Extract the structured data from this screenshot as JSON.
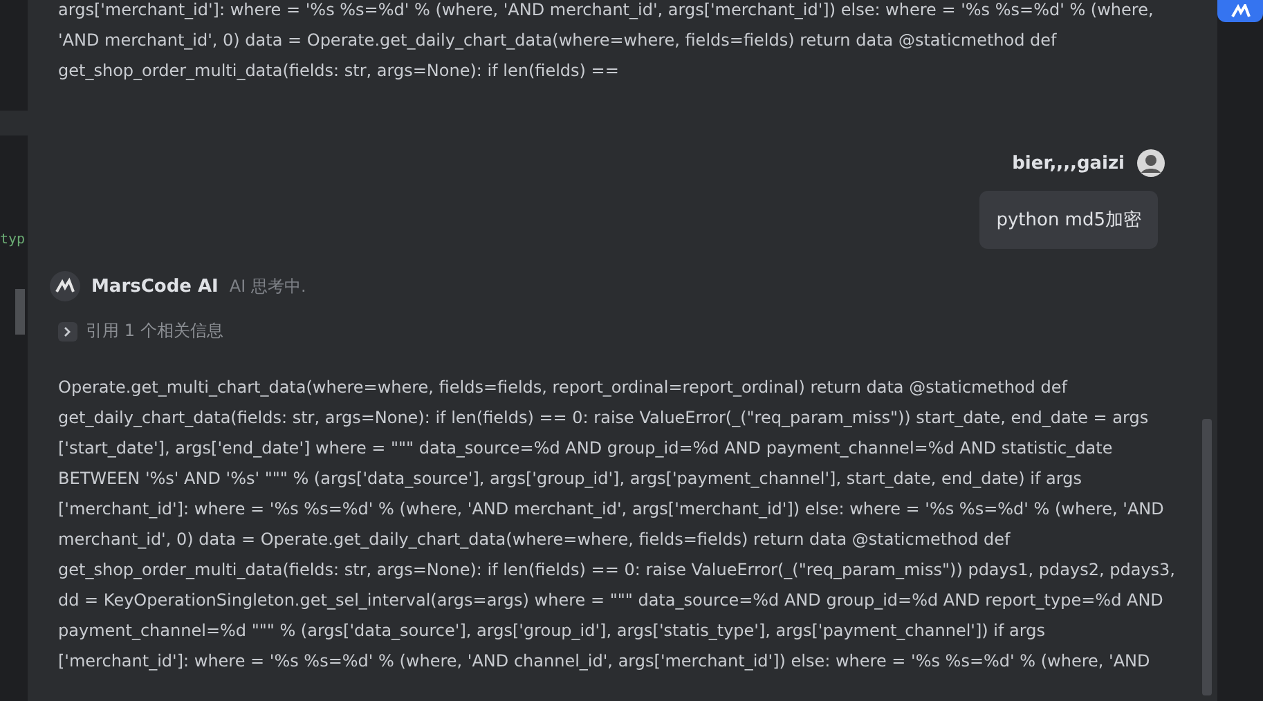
{
  "editor": {
    "snippet": "typ"
  },
  "previous_answer": {
    "lines": [
      "args['merchant_id']: where = '%s %s=%d' % (where, 'AND merchant_id', args['merchant_id']) else: where = '%s %s=%d' % (where,",
      "'AND merchant_id', 0) data = Operate.get_daily_chart_data(where=where, fields=fields) return data @staticmethod def",
      "get_shop_order_multi_data(fields: str, args=None): if len(fields) =="
    ]
  },
  "user_message": {
    "name": "bier,,,,gaizi",
    "text": "python md5加密"
  },
  "ai_message": {
    "name": "MarsCode AI",
    "status": "AI 思考中.",
    "reference": {
      "label": "引用 1 个相关信息",
      "expanded": false
    },
    "lines": [
      "Operate.get_multi_chart_data(where=where, fields=fields, report_ordinal=report_ordinal) return data @staticmethod def",
      "get_daily_chart_data(fields: str, args=None): if len(fields) == 0: raise ValueError(_(\"req_param_miss\")) start_date, end_date = args",
      "['start_date'], args['end_date'] where = \"\"\" data_source=%d AND group_id=%d AND payment_channel=%d AND statistic_date",
      "BETWEEN '%s' AND '%s' \"\"\" % (args['data_source'], args['group_id'], args['payment_channel'], start_date, end_date) if args",
      "['merchant_id']: where = '%s %s=%d' % (where, 'AND merchant_id', args['merchant_id']) else: where = '%s %s=%d' % (where, 'AND",
      "merchant_id', 0) data = Operate.get_daily_chart_data(where=where, fields=fields) return data @staticmethod def",
      "get_shop_order_multi_data(fields: str, args=None): if len(fields) == 0: raise ValueError(_(\"req_param_miss\")) pdays1, pdays2, pdays3,",
      "dd = KeyOperationSingleton.get_sel_interval(args=args) where = \"\"\" data_source=%d AND group_id=%d AND report_type=%d AND",
      "payment_channel=%d \"\"\" % (args['data_source'], args['group_id'], args['statis_type'], args['payment_channel']) if args",
      "['merchant_id']: where = '%s %s=%d' % (where, 'AND channel_id', args['merchant_id']) else: where = '%s %s=%d' % (where, 'AND"
    ]
  }
}
